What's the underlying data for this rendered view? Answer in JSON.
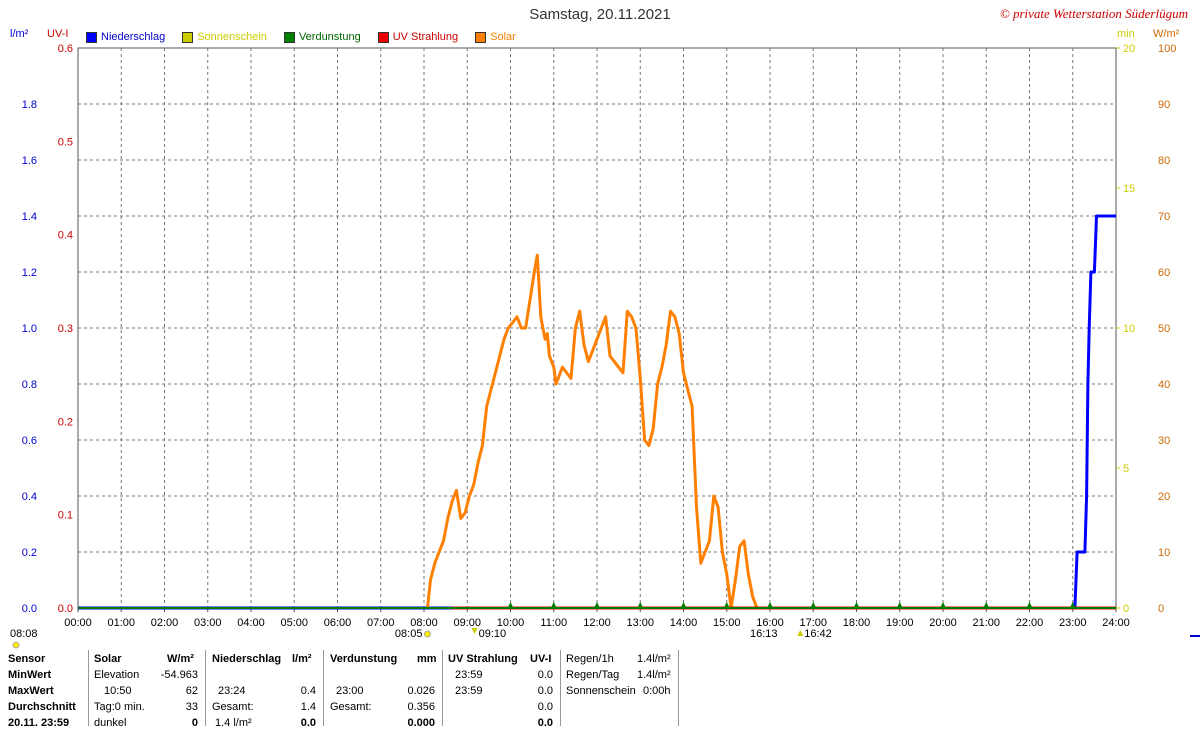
{
  "header": {
    "title": "Samstag, 20.11.2021",
    "copyright": "© private Wetterstation Süderlügum"
  },
  "units": {
    "left1": "l/m²",
    "left2": "UV-I",
    "right1": "min",
    "right2": "W/m²"
  },
  "legend": [
    {
      "label": "Niederschlag",
      "color": "#0000ff",
      "text_color": "#0000cc"
    },
    {
      "label": "Sonnenschein",
      "color": "#cccc00",
      "text_color": "#cccc00"
    },
    {
      "label": "Verdunstung",
      "color": "#008000",
      "text_color": "#006600"
    },
    {
      "label": "UV Strahlung",
      "color": "#ee0000",
      "text_color": "#cc0000"
    },
    {
      "label": "Solar",
      "color": "#ff8000",
      "text_color": "#ff8000"
    }
  ],
  "chart_data": {
    "type": "line",
    "title": "Samstag, 20.11.2021",
    "x_ticks": [
      "00:00",
      "01:00",
      "02:00",
      "03:00",
      "04:00",
      "05:00",
      "06:00",
      "07:00",
      "08:00",
      "09:00",
      "10:00",
      "11:00",
      "12:00",
      "13:00",
      "14:00",
      "15:00",
      "16:00",
      "17:00",
      "18:00",
      "19:00",
      "20:00",
      "21:00",
      "22:00",
      "23:00",
      "24:00"
    ],
    "xlim_hours": [
      0,
      24
    ],
    "axes": {
      "precip": {
        "label": "l/m²",
        "ylim": [
          0,
          2.0
        ],
        "ticks": [
          "0.0",
          "0.2",
          "0.4",
          "0.6",
          "0.8",
          "1.0",
          "1.2",
          "1.4",
          "1.6",
          "1.8"
        ],
        "color": "#0000cc"
      },
      "uv": {
        "label": "UV-I",
        "ylim": [
          0,
          0.6
        ],
        "ticks": [
          "0.0",
          "0.1",
          "0.2",
          "0.3",
          "0.4",
          "0.5",
          "0.6"
        ],
        "color": "#cc0000"
      },
      "sun": {
        "label": "min",
        "ylim": [
          0,
          20
        ],
        "ticks": [
          "0",
          "5",
          "10",
          "15",
          "20"
        ],
        "color": "#cccc00"
      },
      "solar": {
        "label": "W/m²",
        "ylim": [
          0,
          100
        ],
        "ticks": [
          "0",
          "10",
          "20",
          "30",
          "40",
          "50",
          "60",
          "70",
          "80",
          "90",
          "100"
        ],
        "color": "#cc6600"
      }
    },
    "series": [
      {
        "name": "Niederschlag",
        "axis": "precip",
        "color": "#0000ff",
        "x": [
          0,
          23.05,
          23.1,
          23.28,
          23.32,
          23.35,
          23.38,
          23.42,
          23.45,
          23.5,
          23.55,
          23.58,
          23.62,
          24.0
        ],
        "y": [
          0,
          0,
          0.2,
          0.2,
          0.4,
          0.8,
          1.0,
          1.2,
          1.2,
          1.2,
          1.4,
          1.4,
          1.4,
          1.4
        ]
      },
      {
        "name": "Solar",
        "axis": "solar",
        "color": "#ff8000",
        "x": [
          8.08,
          8.15,
          8.25,
          8.35,
          8.45,
          8.55,
          8.65,
          8.75,
          8.85,
          8.95,
          9.05,
          9.15,
          9.25,
          9.35,
          9.45,
          9.55,
          9.65,
          9.75,
          9.85,
          9.95,
          10.05,
          10.15,
          10.25,
          10.35,
          10.45,
          10.55,
          10.62,
          10.7,
          10.75,
          10.8,
          10.85,
          10.9,
          10.95,
          11.0,
          11.05,
          11.1,
          11.2,
          11.3,
          11.4,
          11.5,
          11.6,
          11.7,
          11.8,
          11.9,
          12.0,
          12.1,
          12.2,
          12.3,
          12.4,
          12.5,
          12.6,
          12.7,
          12.8,
          12.9,
          13.0,
          13.1,
          13.2,
          13.3,
          13.4,
          13.5,
          13.6,
          13.7,
          13.8,
          13.9,
          14.0,
          14.1,
          14.2,
          14.3,
          14.4,
          14.5,
          14.6,
          14.7,
          14.8,
          14.9,
          15.0,
          15.1,
          15.2,
          15.3,
          15.4,
          15.5,
          15.6,
          15.7,
          15.8,
          15.9,
          16.0
        ],
        "y": [
          0,
          5,
          8,
          10,
          12,
          16,
          19,
          21,
          16,
          17,
          20,
          22,
          26,
          29,
          36,
          39,
          42,
          45,
          48,
          50,
          51,
          52,
          50,
          50,
          55,
          60,
          63,
          52,
          50,
          48,
          49,
          45,
          44,
          43,
          40,
          41,
          43,
          42,
          41,
          50,
          53,
          47,
          44,
          46,
          48,
          50,
          52,
          45,
          44,
          43,
          42,
          53,
          52,
          50,
          41,
          30,
          29,
          32,
          40,
          43,
          47,
          53,
          52,
          49,
          42,
          39,
          36,
          18,
          8,
          10,
          12,
          20,
          18,
          10,
          6,
          0,
          5,
          11,
          12,
          6,
          2,
          0,
          0,
          0,
          0
        ]
      },
      {
        "name": "UV Strahlung",
        "axis": "uv",
        "color": "#ee0000",
        "x": [
          8.65,
          24.0
        ],
        "y": [
          0,
          0
        ]
      },
      {
        "name": "Verdunstung",
        "axis": "uv",
        "color": "#008000",
        "x": [
          0,
          24.0
        ],
        "y": [
          0,
          0
        ]
      }
    ],
    "markers": {
      "green_ticks_hours": [
        10,
        11,
        12,
        13,
        14,
        15,
        16,
        17,
        18,
        19,
        20,
        21,
        22,
        23
      ],
      "time_labels": [
        {
          "text": "08:08",
          "pos": "left-edge"
        },
        {
          "text": "08:05",
          "at": 8.08
        },
        {
          "text": "09:10",
          "at": 9.17
        },
        {
          "text": "16:13",
          "at": 16.22
        },
        {
          "text": "16:42",
          "at": 16.7
        }
      ]
    }
  },
  "stats": {
    "sensor": {
      "header": "Sensor",
      "rows": [
        "MinWert",
        "MaxWert",
        "Durchschnitt",
        "20.11. 23:59"
      ]
    },
    "solar": {
      "header": "Solar",
      "unit": "W/m²",
      "rows": [
        [
          "Elevation",
          "-54.963"
        ],
        [
          "10:50",
          "62"
        ],
        [
          "Tag:0 min.",
          "33"
        ],
        [
          "dunkel",
          "0"
        ]
      ]
    },
    "niederschlag": {
      "header": "Niederschlag",
      "unit": "l/m²",
      "rows": [
        [
          "",
          ""
        ],
        [
          "23:24",
          "0.4"
        ],
        [
          "Gesamt:",
          "1.4"
        ],
        [
          "1.4 l/m²",
          "0.0"
        ]
      ]
    },
    "verdunstung": {
      "header": "Verdunstung",
      "unit": "mm",
      "rows": [
        [
          "",
          ""
        ],
        [
          "23:00",
          "0.026"
        ],
        [
          "Gesamt:",
          "0.356"
        ],
        [
          "",
          "0.000"
        ]
      ]
    },
    "uv": {
      "header": "UV Strahlung",
      "unit": "UV-I",
      "rows": [
        [
          "23:59",
          "0.0"
        ],
        [
          "23:59",
          "0.0"
        ],
        [
          "",
          "0.0"
        ],
        [
          "",
          "0.0"
        ]
      ]
    },
    "regen": {
      "rows": [
        [
          "Regen/1h",
          "1.4l/m²"
        ],
        [
          "Regen/Tag",
          "1.4l/m²"
        ],
        [
          "Sonnenschein",
          "0:00h"
        ]
      ]
    }
  }
}
